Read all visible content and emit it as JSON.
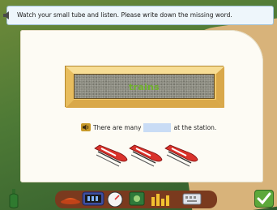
{
  "instruction": {
    "text": "Watch your small tube and listen. Please write down the missing word."
  },
  "exercise": {
    "hidden_word": "trains",
    "sentence_before": "There are many",
    "sentence_after": "at the station.",
    "answer_value": ""
  },
  "icons": {
    "speaker": "speaker-icon",
    "train": "train-icon",
    "done": "checkmark-icon"
  },
  "colors": {
    "accent_green": "#6fb22b",
    "blank_fill": "#c9dcf5",
    "frame_wood": "#f0c96a"
  }
}
